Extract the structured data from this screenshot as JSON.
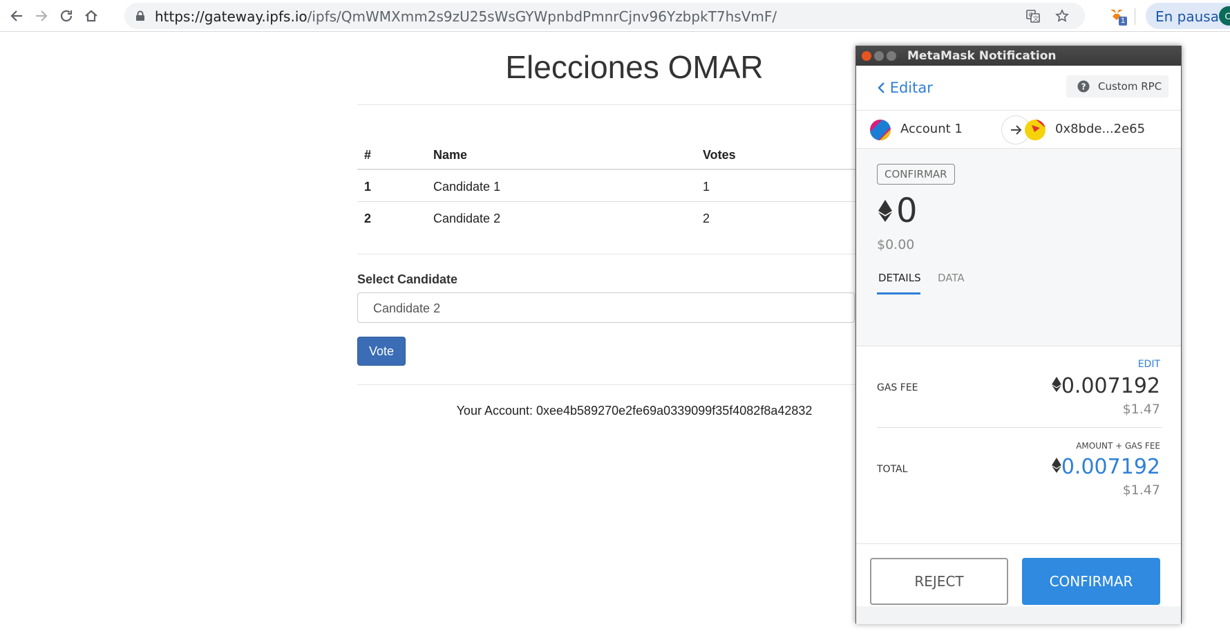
{
  "browser": {
    "url_host": "https://gateway.ipfs.io",
    "url_path": "/ipfs/QmWMXmm2s9zU25sWsGYWpnbdPmnrCjnv96YzbpkT7hsVmF/",
    "extension_badge": "1",
    "profile_label": "En pausa",
    "profile_initial": "O"
  },
  "page": {
    "title": "Elecciones OMAR",
    "table": {
      "headers": [
        "#",
        "Name",
        "Votes"
      ],
      "rows": [
        [
          "1",
          "Candidate 1",
          "1"
        ],
        [
          "2",
          "Candidate 2",
          "2"
        ]
      ]
    },
    "select_label": "Select Candidate",
    "select_value": "Candidate 2",
    "vote_button": "Vote",
    "account_line": "Your Account: 0xee4b589270e2fe69a0339099f35f4082f8a42832"
  },
  "metamask": {
    "window_title": "MetaMask Notification",
    "back_label": "Editar",
    "network_label": "Custom RPC",
    "from_account": "Account 1",
    "to_account": "0x8bde...2e65",
    "action_chip": "CONFIRMAR",
    "amount": "0",
    "amount_fiat": "$0.00",
    "tabs": [
      "DETAILS",
      "DATA"
    ],
    "edit_label": "EDIT",
    "gas_fee_label": "GAS FEE",
    "gas_fee_value": "0.007192",
    "gas_fee_fiat": "$1.47",
    "total_caption": "AMOUNT + GAS FEE",
    "total_label": "TOTAL",
    "total_value": "0.007192",
    "total_fiat": "$1.47",
    "reject_button": "REJECT",
    "confirm_button": "CONFIRMAR",
    "colors": {
      "accent": "#2f8ae0",
      "link": "#2f7fd7"
    }
  }
}
